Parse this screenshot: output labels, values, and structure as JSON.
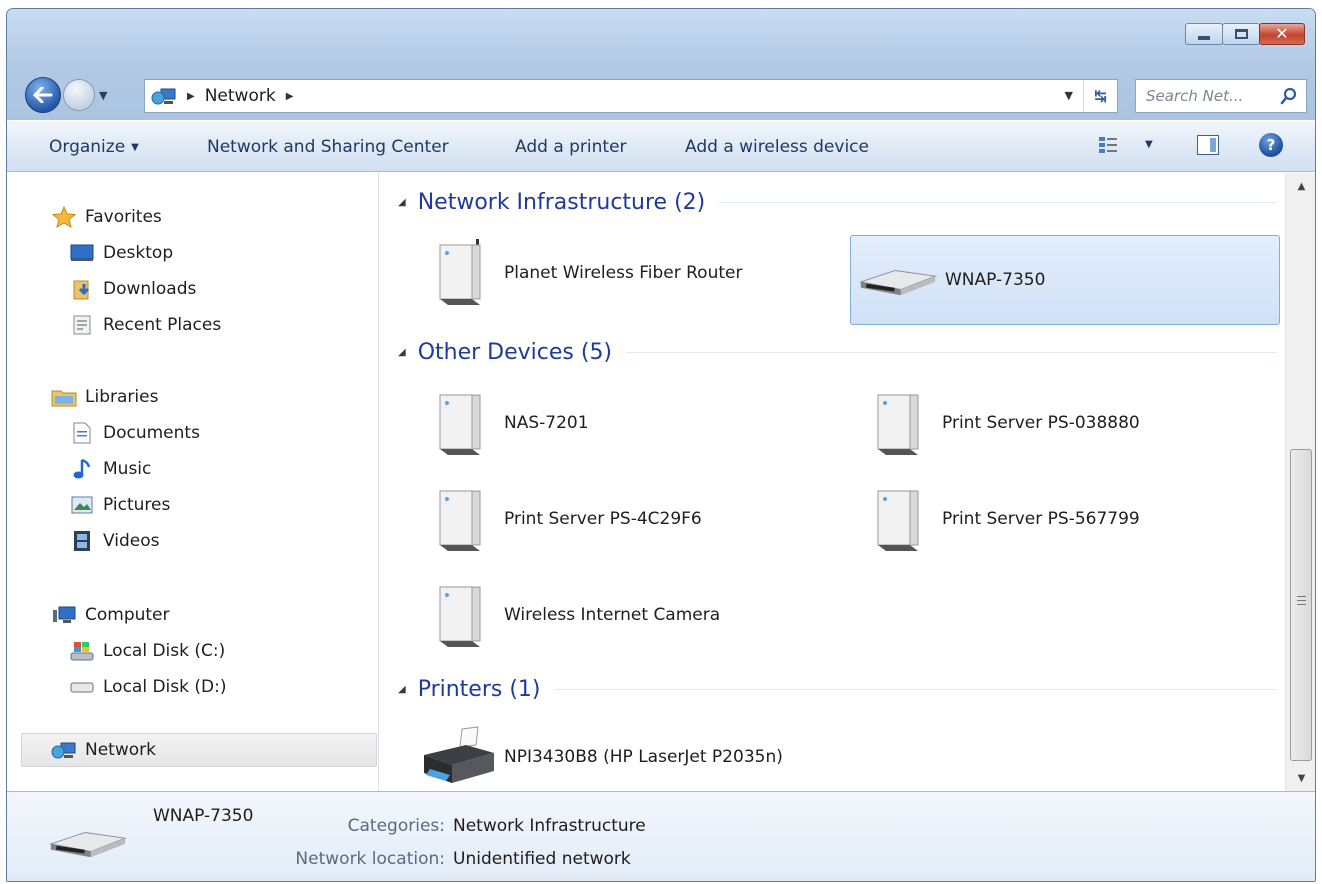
{
  "address_bar": {
    "crumbs": [
      "Network"
    ]
  },
  "search": {
    "placeholder": "Search Net..."
  },
  "toolbar": {
    "organize": "Organize",
    "network_sharing_center": "Network and Sharing Center",
    "add_printer": "Add a printer",
    "add_wireless": "Add a wireless device"
  },
  "sidebar": {
    "favorites": {
      "label": "Favorites",
      "items": [
        "Desktop",
        "Downloads",
        "Recent Places"
      ]
    },
    "libraries": {
      "label": "Libraries",
      "items": [
        "Documents",
        "Music",
        "Pictures",
        "Videos"
      ]
    },
    "computer": {
      "label": "Computer",
      "items": [
        "Local Disk (C:)",
        "Local Disk (D:)"
      ]
    },
    "network": {
      "label": "Network"
    }
  },
  "content": {
    "groups": [
      {
        "title": "Network Infrastructure (2)",
        "items": [
          "Planet Wireless Fiber Router",
          "WNAP-7350"
        ]
      },
      {
        "title": "Other Devices (5)",
        "items": [
          "NAS-7201",
          "Print Server PS-038880",
          "Print Server PS-4C29F6",
          "Print Server PS-567799",
          "Wireless Internet Camera"
        ]
      },
      {
        "title": "Printers (1)",
        "items": [
          "NPI3430B8 (HP LaserJet P2035n)"
        ]
      }
    ],
    "selected_item": "WNAP-7350"
  },
  "details_pane": {
    "name": "WNAP-7350",
    "categories_label": "Categories:",
    "categories_value": "Network Infrastructure",
    "location_label": "Network location:",
    "location_value": "Unidentified network"
  },
  "colors": {
    "group_title": "#1e3a9c",
    "selection_fill": "#d0e1f7",
    "selection_border": "#84acdd",
    "frame": "#b4cbe6"
  }
}
